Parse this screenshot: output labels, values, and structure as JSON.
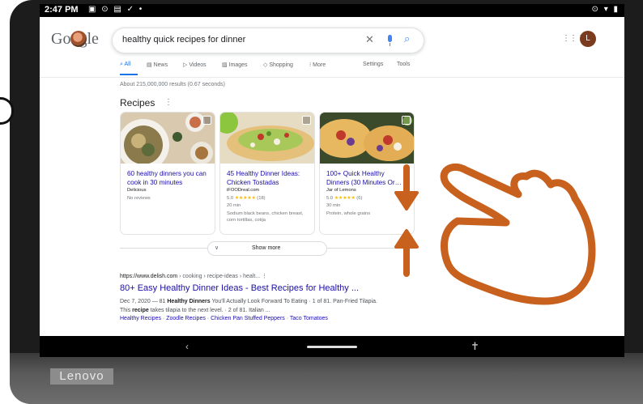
{
  "status_bar": {
    "time": "2:47 PM",
    "left_icons": "▣ ⊙ ▤ ✓ •",
    "right_icons": "⊙ ▾ ▮"
  },
  "device": {
    "brand": "Lenovo"
  },
  "logo": {
    "text": "Google"
  },
  "search": {
    "query": "healthy quick recipes for dinner"
  },
  "header": {
    "avatar_letter": "L",
    "apps_glyph": "⋮⋮⋮"
  },
  "tabs": [
    {
      "label": "All",
      "icon": "search-icon"
    },
    {
      "label": "News",
      "icon": "news-icon"
    },
    {
      "label": "Videos",
      "icon": "video-icon"
    },
    {
      "label": "Images",
      "icon": "image-icon"
    },
    {
      "label": "Shopping",
      "icon": "tag-icon"
    },
    {
      "label": "More",
      "icon": "more-vert-icon"
    },
    {
      "label": "Settings"
    },
    {
      "label": "Tools"
    }
  ],
  "result_stats": "About 215,000,000 results (0.67 seconds)",
  "recipes": {
    "heading": "Recipes",
    "cards": [
      {
        "title": "60 healthy dinners you can cook in 30 minutes",
        "source": "Delicious",
        "rating_text": "No reviews",
        "stars": "",
        "count": "",
        "time": "",
        "description": ""
      },
      {
        "title": "45 Healthy Dinner Ideas: Chicken Tostadas",
        "source": "iFOODreal.com",
        "rating_text": "5.0",
        "stars": "★★★★★",
        "count": "(18)",
        "time": "20 min",
        "description": "Sodium black beans, chicken breast, corn tortillas, cotija"
      },
      {
        "title": "100+ Quick Healthy Dinners (30 Minutes Or…",
        "source": "Jar of Lemons",
        "rating_text": "5.0",
        "stars": "★★★★★",
        "count": "(6)",
        "time": "30 min",
        "description": "Protein, whole grains"
      }
    ],
    "show_more": "Show more"
  },
  "result": {
    "url": "https://www.delish.com",
    "breadcrumbs": "› cooking › recipe-ideas › healt...",
    "title": "80+ Easy Healthy Dinner Ideas - Best Recipes for Healthy ...",
    "snippet_date": "Dec 7, 2020",
    "snippet_pre": " — 81 ",
    "snippet_bold1": "Healthy Dinners",
    "snippet_mid1": " You'll Actually Look Forward To Eating · 1 of 81. Pan-Fried Tilapia. This ",
    "snippet_bold2": "recipe",
    "snippet_mid2": " takes tilapia to the next level. · 2 of 81. Italian ...",
    "sitelinks": [
      "Healthy Recipes",
      "Zoodle Recipes",
      "Chicken Pan Stuffed Peppers",
      "Taco Tomatoes"
    ]
  },
  "colors": {
    "link": "#1a0dab",
    "accent": "#1a73e8",
    "gesture": "#c8601e",
    "stars": "#fbbc04"
  }
}
